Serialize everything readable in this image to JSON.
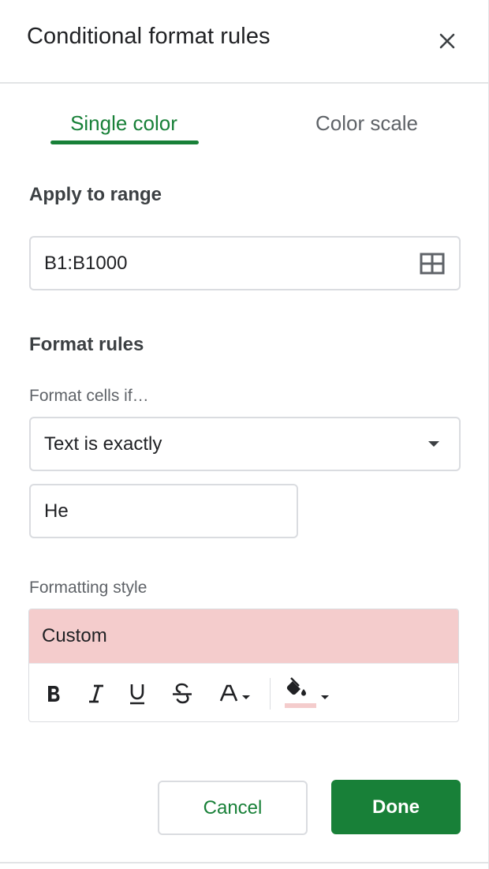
{
  "header": {
    "title": "Conditional format rules",
    "close_icon": "close-icon"
  },
  "tabs": [
    {
      "label": "Single color",
      "active": true
    },
    {
      "label": "Color scale",
      "active": false
    }
  ],
  "apply_range": {
    "title": "Apply to range",
    "value": "B1:B1000",
    "icon": "grid-icon"
  },
  "format_rules": {
    "title": "Format rules",
    "condition_label": "Format cells if…",
    "condition_value": "Text is exactly",
    "value_input": "He"
  },
  "formatting_style": {
    "label": "Formatting style",
    "preview_text": "Custom",
    "preview_fill": "#f4cccc",
    "toolbar": [
      "bold-icon",
      "italic-icon",
      "underline-icon",
      "strikethrough-icon",
      "text-color-icon",
      "fill-color-icon"
    ]
  },
  "actions": {
    "cancel": "Cancel",
    "done": "Done"
  },
  "colors": {
    "accent": "#188038",
    "border": "#dadce0"
  }
}
